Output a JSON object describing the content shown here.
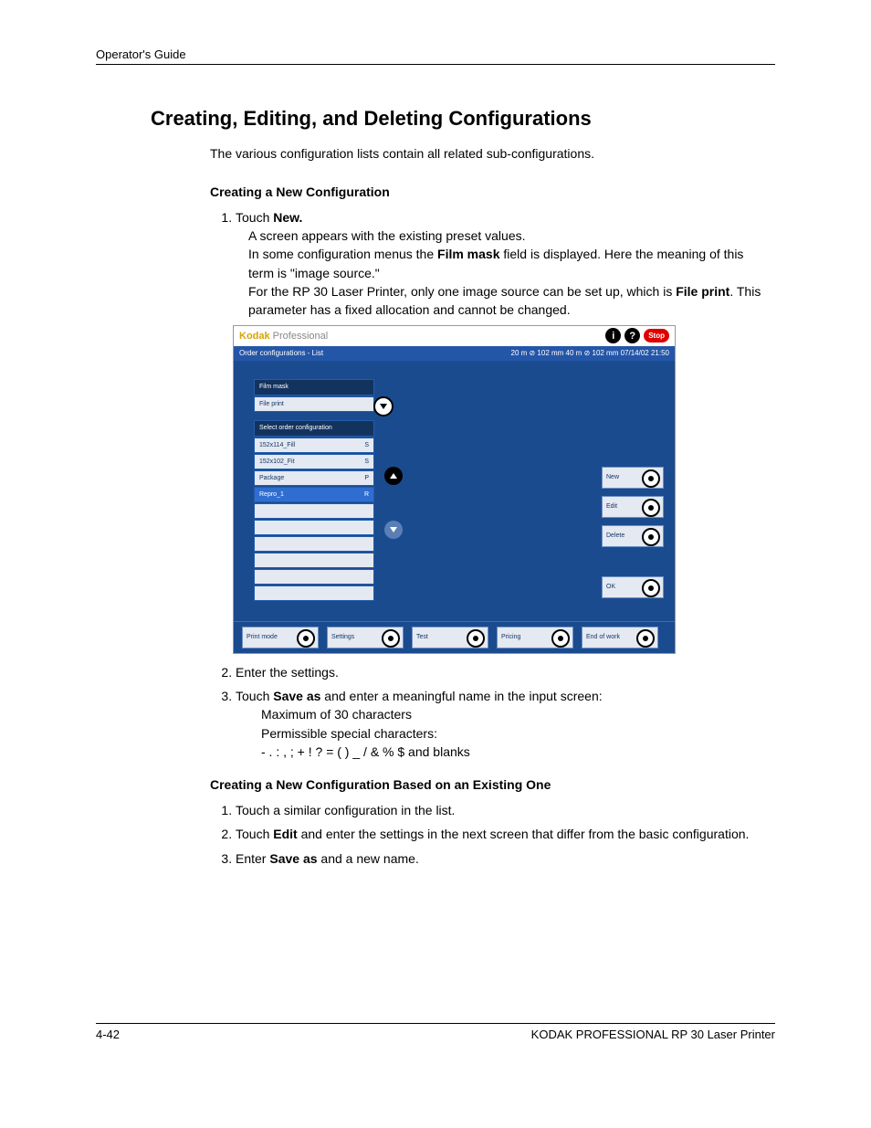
{
  "header": "Operator's Guide",
  "title": "Creating, Editing, and Deleting Configurations",
  "intro": "The various configuration lists contain all related sub-configurations.",
  "section1": {
    "heading": "Creating a New Configuration",
    "step1_a": "Touch ",
    "step1_b": "New.",
    "step1_line2": "A screen appears with the existing preset values.",
    "step1_line3a": "In some configuration menus the ",
    "step1_line3b": "Film mask",
    "step1_line3c": " field is displayed. Here the meaning of this term is \"image source.\"",
    "step1_line4a": "For the RP 30 Laser Printer, only one image source can be set up, which is ",
    "step1_line4b": "File print",
    "step1_line4c": ". This parameter has a fixed allocation and cannot be changed.",
    "step2": "Enter the settings.",
    "step3_a": "Touch ",
    "step3_b": "Save as",
    "step3_c": " and enter a meaningful name in the input screen:",
    "step3_sub1": "Maximum of 30 characters",
    "step3_sub2": "Permissible special characters:",
    "step3_sub3": "-  .  :  ,  ;  +  !  ?  =  (  )  _  /  &  %  $ and blanks"
  },
  "section2": {
    "heading": "Creating a New Configuration Based on an Existing One",
    "step1": "Touch a similar configuration in the list.",
    "step2_a": "Touch ",
    "step2_b": "Edit",
    "step2_c": " and enter the settings in the next screen that differ from the basic configuration.",
    "step3_a": "Enter ",
    "step3_b": "Save as",
    "step3_c": " and a new name."
  },
  "screenshot": {
    "brand1": "Kodak",
    "brand2": " Professional",
    "stop": "Stop",
    "info_glyph": "i",
    "help_glyph": "?",
    "bluebar_left": "Order configurations -  List",
    "bluebar_right": "20 m ⊘ 102 mm   40 m ⊘ 102 mm  07/14/02      21:50",
    "field_filmmask": "Film mask",
    "field_fileprint": "File print",
    "field_select": "Select order configuration",
    "rows": [
      {
        "name": "152x114_Fill",
        "tag": "S"
      },
      {
        "name": "152x102_Fit",
        "tag": "S"
      },
      {
        "name": "Package",
        "tag": "P"
      },
      {
        "name": "Repro_1",
        "tag": "R"
      }
    ],
    "btn_new": "New",
    "btn_edit": "Edit",
    "btn_delete": "Delete",
    "btn_ok": "OK",
    "bot": [
      "Print mode",
      "Settings",
      "Test",
      "Pricing",
      "End of work"
    ]
  },
  "footer": {
    "left": "4-42",
    "right": "KODAK PROFESSIONAL RP 30 Laser Printer"
  }
}
